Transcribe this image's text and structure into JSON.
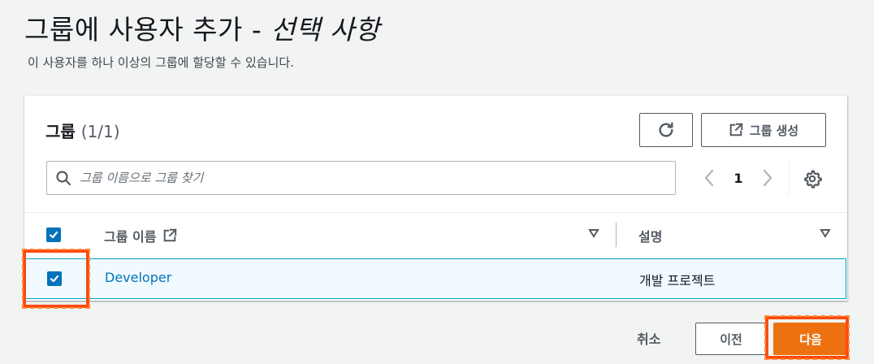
{
  "page": {
    "title": "그룹에 사용자 추가 -",
    "title_optional": "선택 사항",
    "description": "이 사용자를 하나 이상의 그룹에 할당할 수 있습니다."
  },
  "groups_panel": {
    "heading": "그룹",
    "count": "(1/1)",
    "create_button_label": "그룹 생성",
    "search_placeholder": "그룹 이름으로 그룹 찾기",
    "page_number": "1",
    "columns": [
      "그룹 이름",
      "설명"
    ],
    "rows": [
      {
        "selected": true,
        "name": "Developer",
        "description": "개발 프로젝트"
      }
    ]
  },
  "footer": {
    "cancel_label": "취소",
    "previous_label": "이전",
    "next_label": "다음"
  },
  "colors": {
    "primary_button": "#ec7211",
    "link": "#0073bb",
    "checkbox": "#0073bb",
    "highlight": "#ff4a0a"
  }
}
